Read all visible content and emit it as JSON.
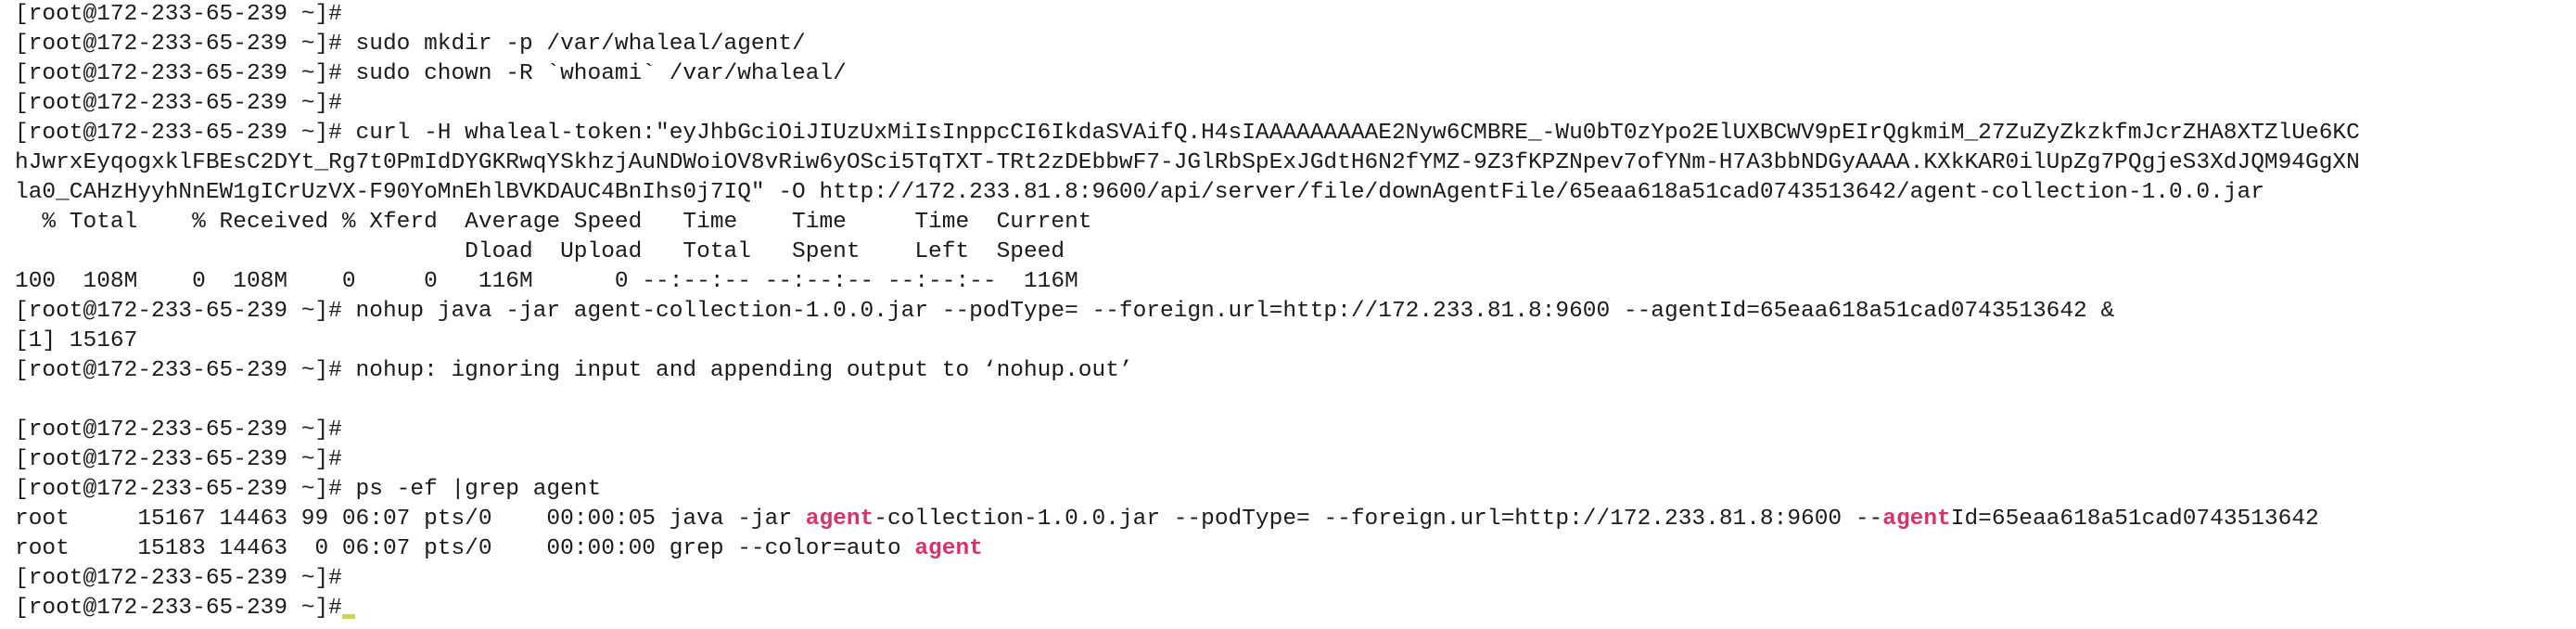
{
  "terminal": {
    "lines": [
      "[root@172-233-65-239 ~]#",
      "[root@172-233-65-239 ~]# sudo mkdir -p /var/whaleal/agent/",
      "[root@172-233-65-239 ~]# sudo chown -R `whoami` /var/whaleal/",
      "[root@172-233-65-239 ~]#",
      "[root@172-233-65-239 ~]# curl -H whaleal-token:\"eyJhbGciOiJIUzUxMiIsInppcCI6IkdaSVAifQ.H4sIAAAAAAAAAE2Nyw6CMBRE_-Wu0bT0zYpo2ElUXBCWV9pEIrQgkmiM_27ZuZyZkzkfmJcrZHA8XTZlUe6KC",
      "hJwrxEyqogxklFBEsC2DYt_Rg7t0PmIdDYGKRwqYSkhzjAuNDWoiOV8vRiw6yOSci5TqTXT-TRt2zDEbbwF7-JGlRbSpExJGdtH6N2fYMZ-9Z3fKPZNpev7ofYNm-H7A3bbNDGyAAAA.KXkKAR0ilUpZg7PQgjeS3XdJQM94GgXN",
      "la0_CAHzHyyhNnEW1gICrUzVX-F90YoMnEhlBVKDAUC4BnIhs0j7IQ\" -O http://172.233.81.8:9600/api/server/file/downAgentFile/65eaa618a51cad0743513642/agent-collection-1.0.0.jar",
      "  % Total    % Received % Xferd  Average Speed   Time    Time     Time  Current",
      "                                 Dload  Upload   Total   Spent    Left  Speed",
      "100  108M    0  108M    0     0   116M      0 --:--:-- --:--:-- --:--:--  116M",
      "[root@172-233-65-239 ~]# nohup java -jar agent-collection-1.0.0.jar --podType= --foreign.url=http://172.233.81.8:9600 --agentId=65eaa618a51cad0743513642 &",
      "[1] 15167",
      "[root@172-233-65-239 ~]# nohup: ignoring input and appending output to ‘nohup.out’",
      "",
      "[root@172-233-65-239 ~]#",
      "[root@172-233-65-239 ~]#",
      "[root@172-233-65-239 ~]# ps -ef |grep agent"
    ],
    "ps_row_1": {
      "pre": "root     15167 14463 99 06:07 pts/0    00:00:05 java -jar ",
      "match_1": "agent",
      "mid": "-collection-1.0.0.jar --podType= --foreign.url=http://172.233.81.8:9600 --",
      "match_2": "agent",
      "post": "Id=65eaa618a51cad0743513642"
    },
    "ps_row_2": {
      "pre": "root     15183 14463  0 06:07 pts/0    00:00:00 grep --color=auto ",
      "match": "agent"
    },
    "tail_lines": [
      "[root@172-233-65-239 ~]#",
      "[root@172-233-65-239 ~]#"
    ],
    "colors": {
      "background": "#ffffff",
      "text": "#1b1b1b",
      "grep_highlight": "#d6336c",
      "cursor": "#c9d84b"
    }
  }
}
